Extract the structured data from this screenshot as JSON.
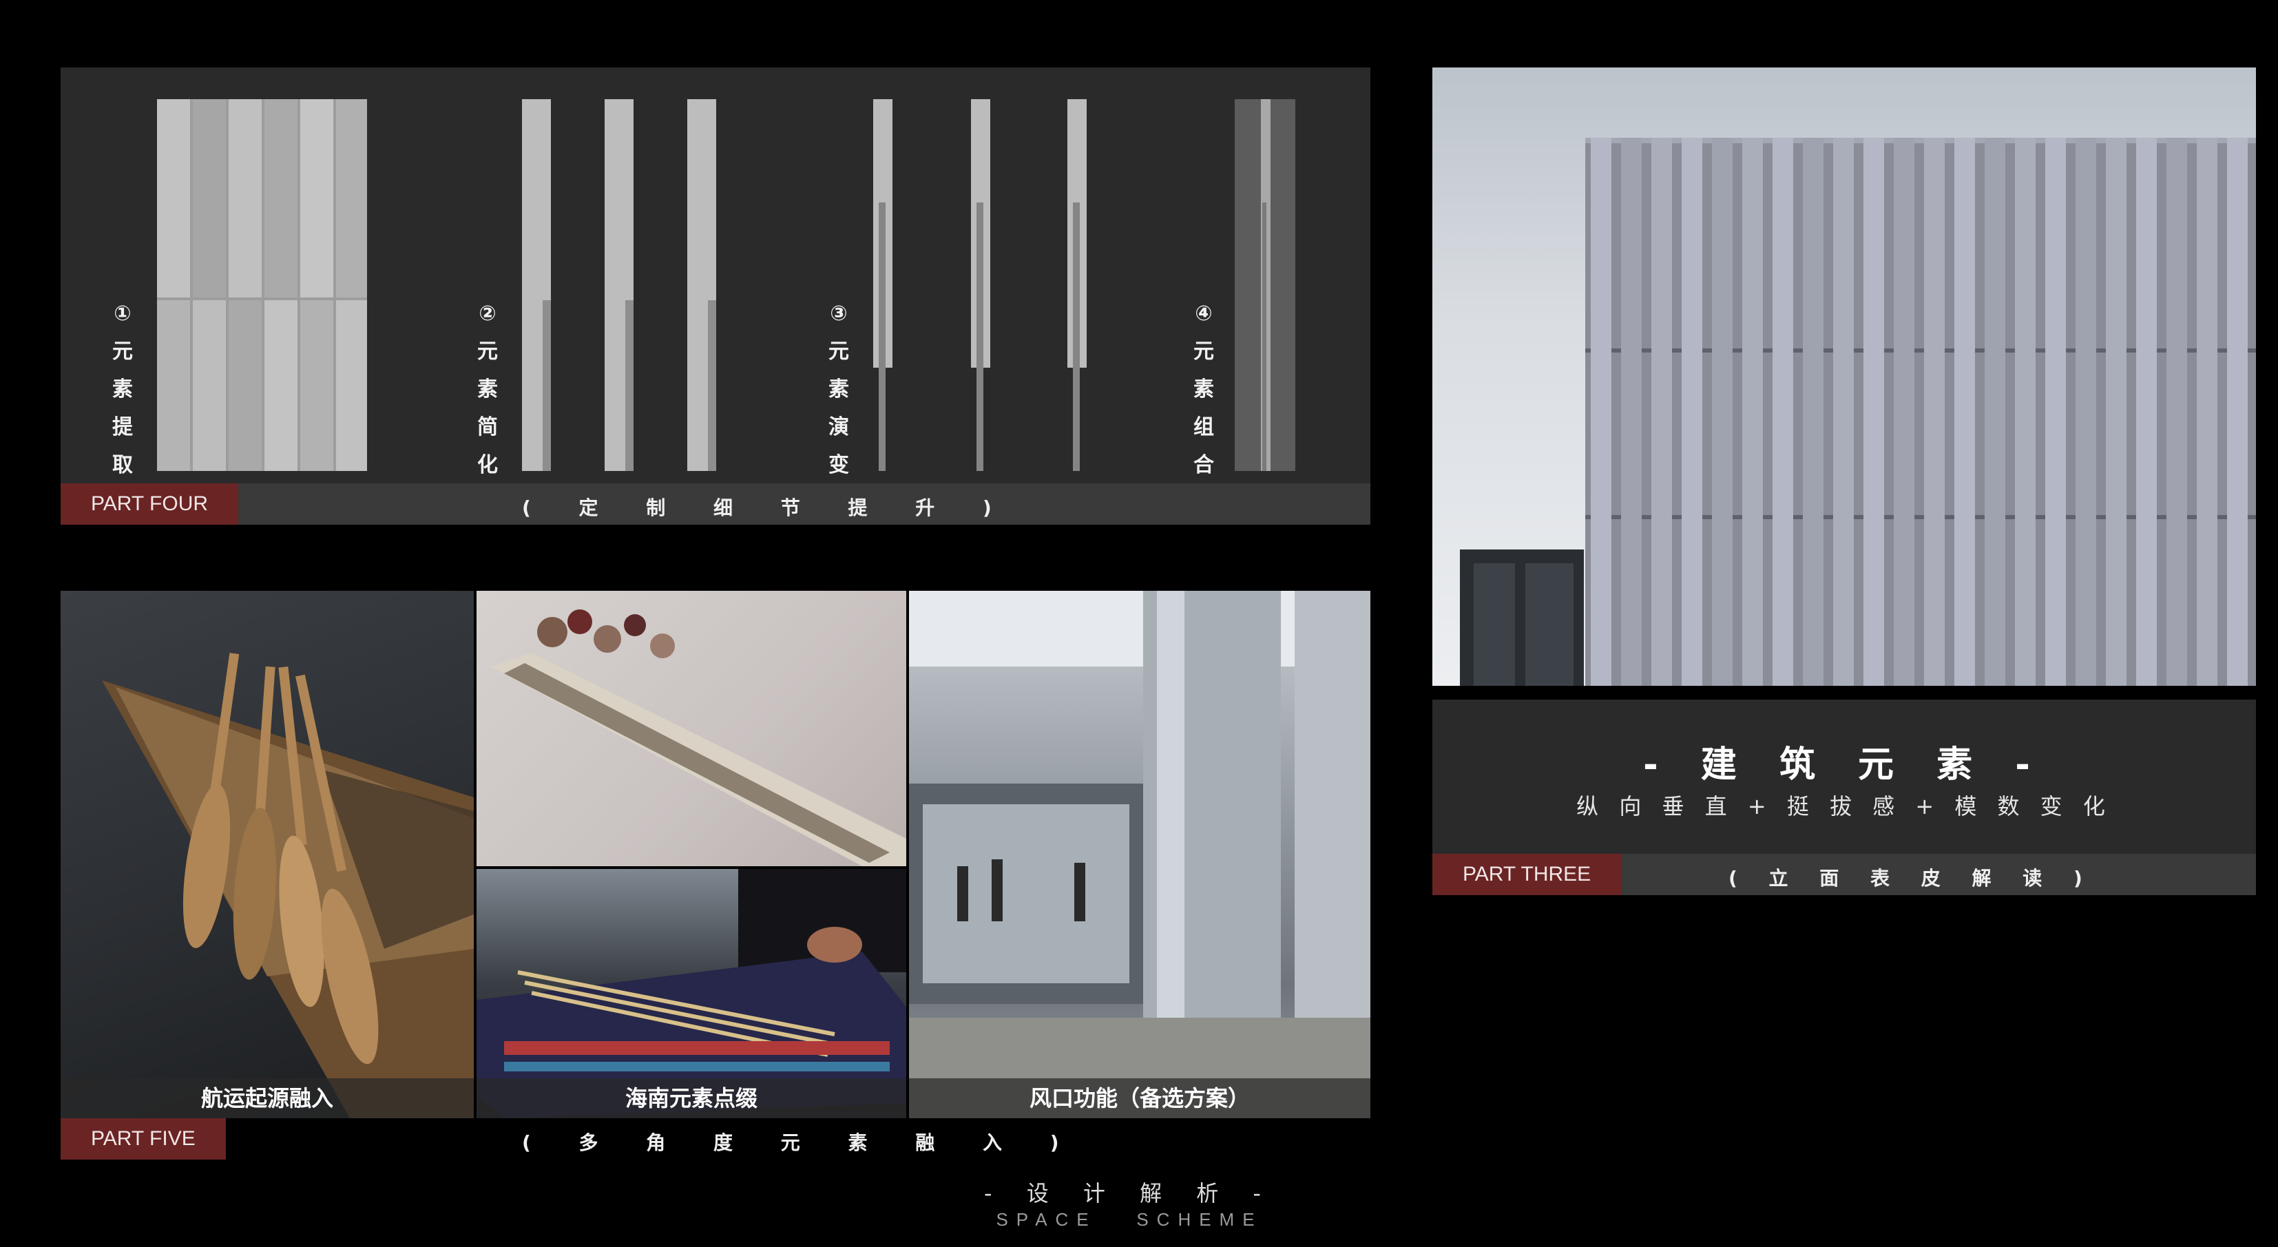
{
  "part_four": {
    "tag": "PART FOUR",
    "caption": "( 定 制 细 节 提 升 )",
    "steps": [
      {
        "num": "①",
        "chars": [
          "元",
          "素",
          "提",
          "取"
        ]
      },
      {
        "num": "②",
        "chars": [
          "元",
          "素",
          "简",
          "化"
        ]
      },
      {
        "num": "③",
        "chars": [
          "元",
          "素",
          "演",
          "变"
        ]
      },
      {
        "num": "④",
        "chars": [
          "元",
          "素",
          "组",
          "合"
        ]
      }
    ]
  },
  "part_five": {
    "tag": "PART FIVE",
    "caption": "( 多 角 度 元 素 融 入 )",
    "photos": [
      {
        "caption": "航运起源融入"
      },
      {
        "caption": "海南元素点缀"
      },
      {
        "caption": "风口功能（备选方案）"
      }
    ]
  },
  "part_three": {
    "tag": "PART THREE",
    "caption": "( 立 面 表 皮 解 读 )",
    "title": "- 建 筑 元 素 -",
    "subtitle": "纵 向 垂 直 + 挺 拔 感 + 模 数 变 化"
  },
  "footer": {
    "title": "- 设 计 解 析 -",
    "subtitle": "SPACE   SCHEME"
  }
}
